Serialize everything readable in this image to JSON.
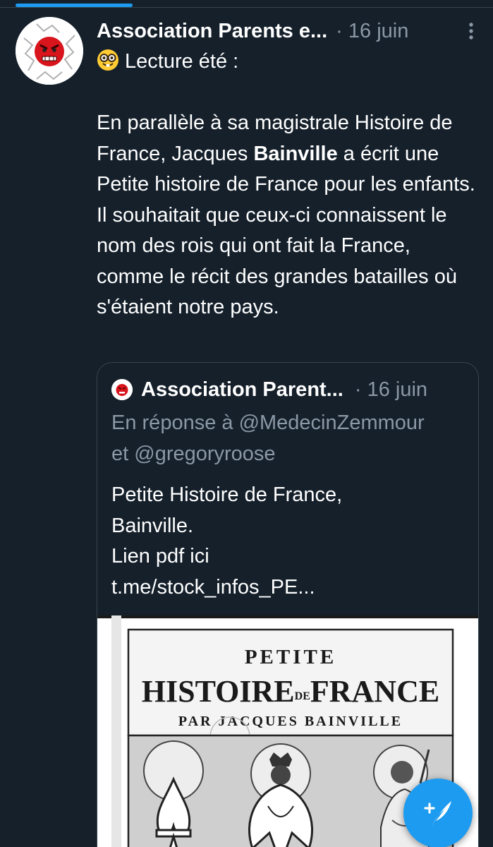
{
  "tweet": {
    "author_name": "Association Parents e...",
    "separator": "·",
    "date": "16 juin",
    "intro_emoji": "nerd-face",
    "intro_text": "Lecture été :",
    "body_before_bold": "En parallèle à sa magistrale Histoire de France, Jacques ",
    "body_bold": "Bainville",
    "body_after_bold": " a écrit une Petite histoire de France pour les enfants. Il souhaitait que ceux-ci connaissent le nom des rois qui ont fait la France, comme le récit des grandes batailles où s'étaient notre pays."
  },
  "quoted_tweet": {
    "author_name": "Association Parent...",
    "separator": "·",
    "date": "16 juin",
    "reply_prefix": "En réponse à",
    "reply_user_1": "@MedecinZemmour",
    "reply_joiner": "et",
    "reply_user_2": "@gregoryroose",
    "text_lines": [
      "Petite Histoire de France,",
      "Bainville.",
      "Lien pdf ici",
      "t.me/stock_infos_PE..."
    ],
    "image": {
      "line_1": "PETITE",
      "line_2_a": "HISTOIRE",
      "line_2_small": "DE",
      "line_2_b": "FRANCE",
      "line_3": "PAR JACQUES BAINVILLE"
    }
  },
  "compose_button": {
    "icon": "feather-plus-icon"
  },
  "colors": {
    "background": "#15202b",
    "text": "#ffffff",
    "secondary_text": "#8b98a5",
    "border": "#38444d",
    "accent": "#1d9bf0"
  }
}
